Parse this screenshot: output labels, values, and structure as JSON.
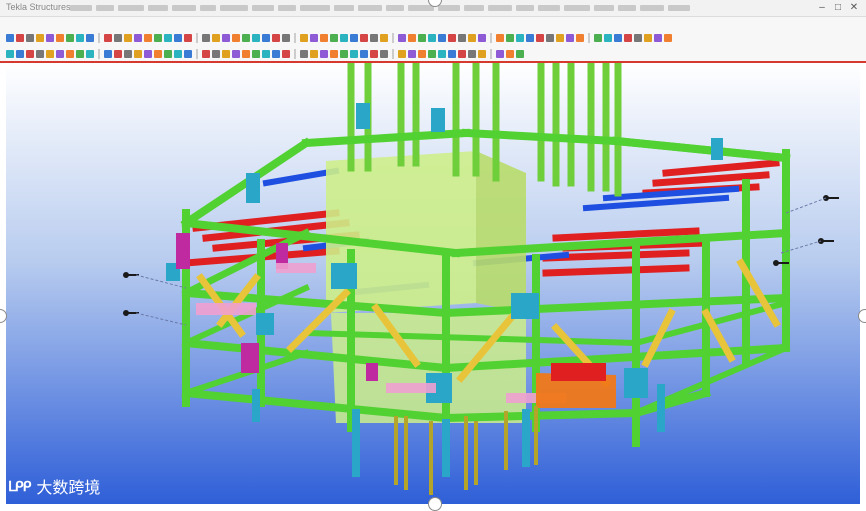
{
  "window": {
    "title": "Tekla Structures",
    "controls": {
      "minimize": "–",
      "maximize": "□",
      "close": "✕"
    }
  },
  "menu_item_count": 24,
  "ribbon": {
    "row_counts": [
      62,
      48
    ],
    "accent": "#d63a2f",
    "tool_colors": [
      "#3a7bd5",
      "#e0a020",
      "#4caf50",
      "#d64545",
      "#8e5ad6",
      "#2bb3c0",
      "#777777",
      "#f08030"
    ]
  },
  "viewport": {
    "background_top": "#ffffff",
    "background_bottom": "#2f5fd8"
  },
  "model_colors": {
    "frame": "#52d132",
    "frame_dark": "#2c9a1e",
    "column": "#6fcf3a",
    "brace": "#e8c43a",
    "deck_beam": "#e02020",
    "blue_beam": "#1e4fe0",
    "cyan_plate": "#2aa7c8",
    "magenta": "#c02aa0",
    "pink": "#f0a0d0",
    "core": "#cdee8a",
    "orange": "#f07818",
    "support": "#b4a52a"
  },
  "watermark": {
    "logo": "ᒪᑭᑭ",
    "text": "大数跨境"
  }
}
